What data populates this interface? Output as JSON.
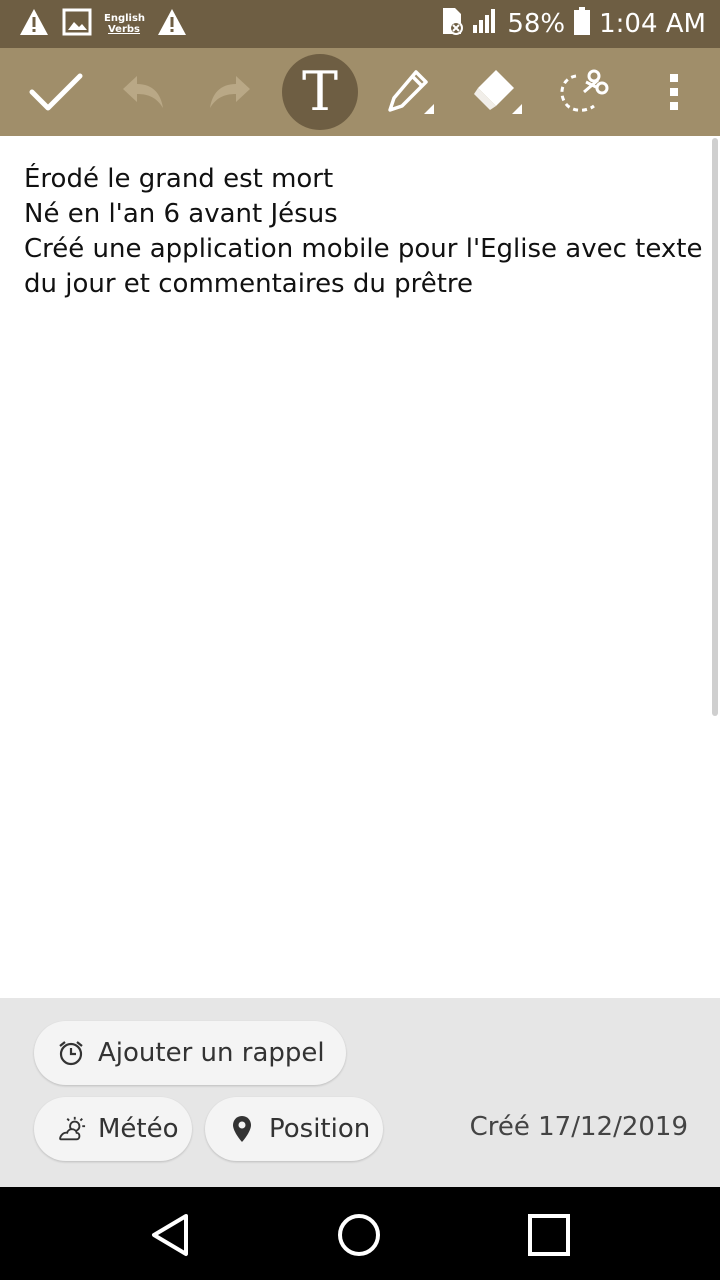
{
  "status_bar": {
    "battery": "58%",
    "time": "1:04 AM",
    "app_badge": [
      "English",
      "Verbs"
    ],
    "icons": [
      "warning-icon",
      "image-icon",
      "english-verbs-icon",
      "warning-icon",
      "sd-card-icon",
      "signal-icon",
      "battery-icon"
    ]
  },
  "toolbar": {
    "tools": [
      "confirm",
      "undo",
      "redo",
      "text",
      "pen",
      "eraser",
      "lasso",
      "more"
    ],
    "active_tool": "text",
    "text_tool_glyph": "T"
  },
  "note": {
    "lines": [
      "Érodé le grand est mort",
      "Né en l'an 6 avant Jésus",
      "Créé une application mobile pour l'Eglise avec texte",
      "du jour et commentaires du prêtre"
    ]
  },
  "bottom": {
    "reminder_label": "Ajouter un rappel",
    "weather_label": "Météo",
    "location_label": "Position",
    "created_text": "Créé 17/12/2019"
  },
  "nav": {
    "buttons": [
      "back",
      "home",
      "recents"
    ]
  },
  "colors": {
    "status_bar": "#6e5e43",
    "toolbar": "#a08e6a",
    "active_tool_bg": "#6e5e43",
    "bottom_panel": "#e6e6e6"
  }
}
